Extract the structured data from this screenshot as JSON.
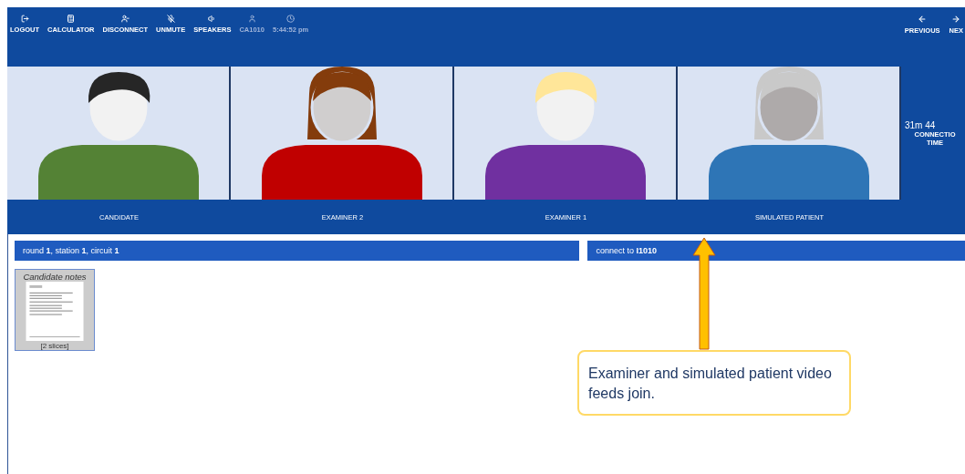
{
  "toolbar": {
    "items": [
      {
        "kind": "button",
        "label": "LOGOUT"
      },
      {
        "kind": "button",
        "label": "CALCULATOR"
      },
      {
        "kind": "button",
        "label": "DISCONNECT"
      },
      {
        "kind": "button",
        "label": "UNMUTE"
      },
      {
        "kind": "button",
        "label": "SPEAKERS"
      },
      {
        "kind": "info",
        "label": "CA1010"
      },
      {
        "kind": "info",
        "label": "5:44:52 pm"
      }
    ],
    "nav": [
      {
        "label": "PREVIOUS"
      },
      {
        "label": "NEX"
      }
    ]
  },
  "videos": [
    {
      "label": "CANDIDATE",
      "kind": "short-dark",
      "color": "#548235"
    },
    {
      "label": "EXAMINER 2",
      "kind": "long-brown",
      "color": "#c00000"
    },
    {
      "label": "EXAMINER 1",
      "kind": "short-blond",
      "color": "#7030a0"
    },
    {
      "label": "SIMULATED PATIENT",
      "kind": "long-grey",
      "color": "#2e75b6"
    }
  ],
  "connection": {
    "value": "31m 44",
    "label": "CONNECTIO",
    "label_2": "TIME"
  },
  "info_bars": [
    "round **1**, station **1**, circuit **1**",
    "connect to **I1010**"
  ],
  "notes": {
    "title": "Candidate notes",
    "caption": "[2 slices]"
  },
  "callout": {
    "text": "Examiner and simulated patient video feeds join."
  }
}
